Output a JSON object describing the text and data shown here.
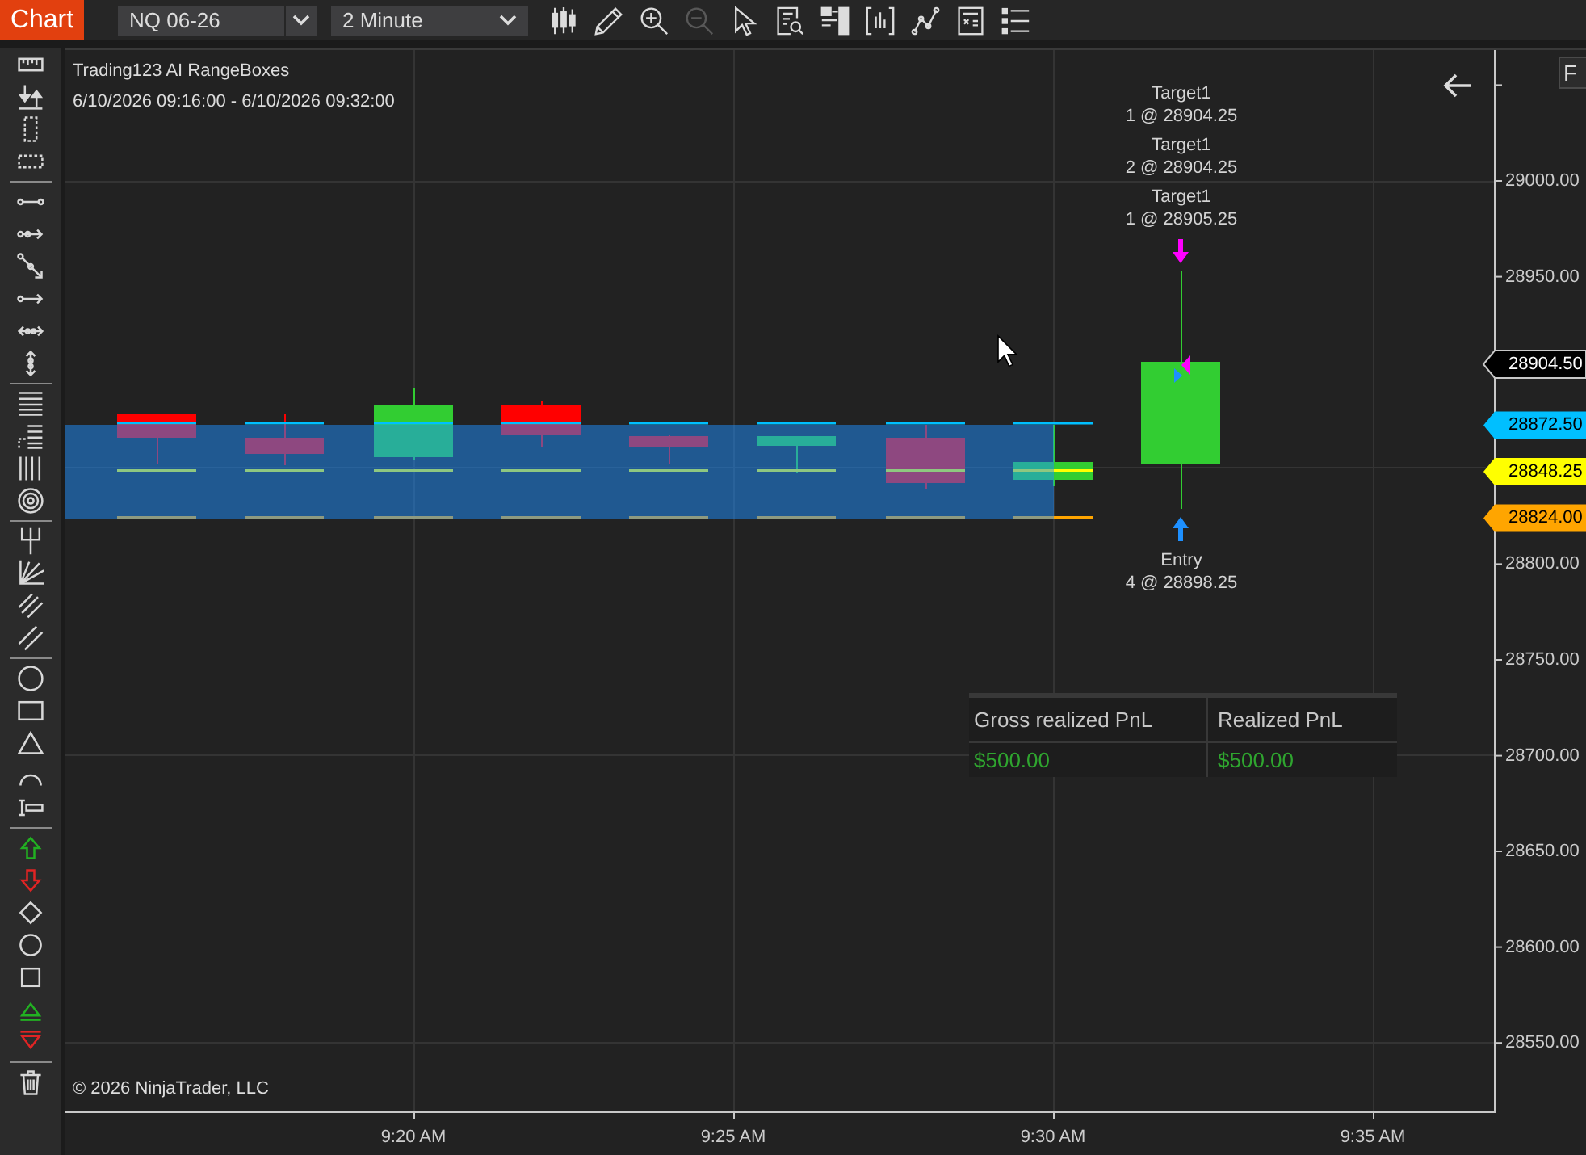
{
  "window": {
    "title": "Chart"
  },
  "instrument": {
    "value": "NQ 06-26"
  },
  "interval": {
    "value": "2 Minute"
  },
  "toolbar_buttons": [
    {
      "kind": "candles",
      "disabled": false
    },
    {
      "kind": "pencil",
      "disabled": false
    },
    {
      "kind": "zoomin",
      "disabled": false
    },
    {
      "kind": "zoomout",
      "disabled": true
    },
    {
      "kind": "pointer",
      "disabled": false
    },
    {
      "kind": "docsearch",
      "disabled": false
    },
    {
      "kind": "panel",
      "disabled": false
    },
    {
      "kind": "barchart",
      "disabled": false
    },
    {
      "kind": "linechart",
      "disabled": false
    },
    {
      "kind": "sheet",
      "disabled": false
    },
    {
      "kind": "list",
      "disabled": false
    }
  ],
  "chart": {
    "indicator_title": "Trading123 AI RangeBoxes",
    "date_range": "6/10/2026 09:16:00 - 6/10/2026 09:32:00",
    "corner_button": {
      "label": "F"
    },
    "candles": [
      {
        "kind": "down"
      },
      {
        "kind": "down"
      },
      {
        "kind": "up"
      },
      {
        "kind": "down"
      },
      {
        "kind": "down"
      },
      {
        "kind": "up"
      },
      {
        "kind": "down"
      },
      {
        "kind": "up"
      },
      {
        "kind": "up"
      }
    ],
    "order_labels": [
      {
        "kind": "target",
        "name": "Target1",
        "fill": "1 @ 28904.25"
      },
      {
        "kind": "target",
        "name": "Target1",
        "fill": "2 @ 28904.25"
      },
      {
        "kind": "target",
        "name": "Target1",
        "fill": "1 @ 28905.25"
      },
      {
        "kind": "entry",
        "name": "Entry",
        "fill": "4 @ 28898.25"
      }
    ],
    "price_axis": {
      "labels": [
        "29000.00",
        "28950.00",
        "28800.00",
        "28750.00",
        "28700.00",
        "28650.00",
        "28600.00",
        "28550.00"
      ]
    },
    "price_tags": [
      {
        "value": "28904.50",
        "color": "#000000"
      },
      {
        "value": "28872.50",
        "color": "#00bfff"
      },
      {
        "value": "28848.25",
        "color": "#ffff00"
      },
      {
        "value": "28824.00",
        "color": "#ffa500"
      }
    ],
    "time_axis": {
      "labels": [
        "9:20 AM",
        "9:25 AM",
        "9:30 AM",
        "9:35 AM"
      ]
    },
    "pnl_table": {
      "columns": [
        "Gross realized PnL",
        "Realized PnL"
      ],
      "rows": [
        [
          "$500.00",
          "$500.00"
        ]
      ]
    },
    "copyright": "© 2026 NinjaTrader, LLC"
  }
}
